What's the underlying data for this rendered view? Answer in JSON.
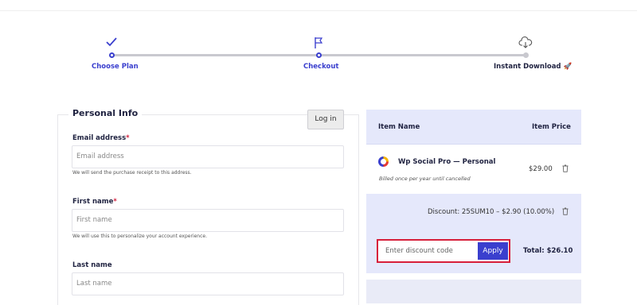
{
  "stepper": {
    "steps": [
      {
        "label": "Choose Plan",
        "icon": "check-icon",
        "state": "done"
      },
      {
        "label": "Checkout",
        "icon": "flag-icon",
        "state": "active"
      },
      {
        "label": "Instant Download",
        "emoji": "🚀",
        "icon": "cloud-download-icon",
        "state": "upcoming"
      }
    ]
  },
  "personal_info": {
    "legend": "Personal Info",
    "login_label": "Log in",
    "email": {
      "label": "Email address",
      "required_mark": "*",
      "placeholder": "Email address",
      "hint": "We will send the purchase receipt to this address."
    },
    "first_name": {
      "label": "First name",
      "required_mark": "*",
      "placeholder": "First name",
      "hint": "We will use this to personalize your account experience."
    },
    "last_name": {
      "label": "Last name",
      "placeholder": "Last name"
    }
  },
  "summary": {
    "col_item": "Item Name",
    "col_price": "Item Price",
    "item": {
      "name": "Wp Social Pro — Personal",
      "note": "Billed once per year until cancelled",
      "price": "$29.00"
    },
    "discount_text": "Discount:  25SUM10 – $2.90 (10.00%)",
    "code_placeholder": "Enter discount code",
    "apply_label": "Apply",
    "total": "Total: $26.10"
  },
  "colors": {
    "accent": "#3a3fce",
    "highlight_border": "#d71f3a",
    "summary_bg": "#e5e8fb"
  }
}
